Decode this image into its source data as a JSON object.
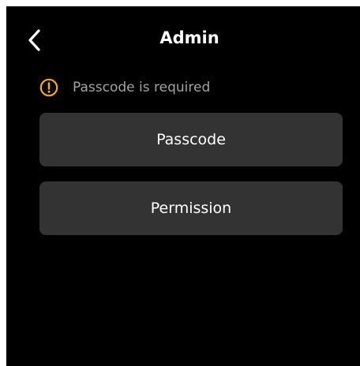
{
  "header": {
    "title": "Admin",
    "back_icon": "chevron-left-icon"
  },
  "warning": {
    "icon": "exclamation-circle-icon",
    "icon_color": "#F5A623",
    "text": "Passcode is required"
  },
  "menu": {
    "items": [
      {
        "label": "Passcode"
      },
      {
        "label": "Permission"
      }
    ]
  },
  "colors": {
    "background": "#000000",
    "button_background": "#333333",
    "text_primary": "#FFFFFF",
    "text_secondary": "#A3A3A3"
  }
}
